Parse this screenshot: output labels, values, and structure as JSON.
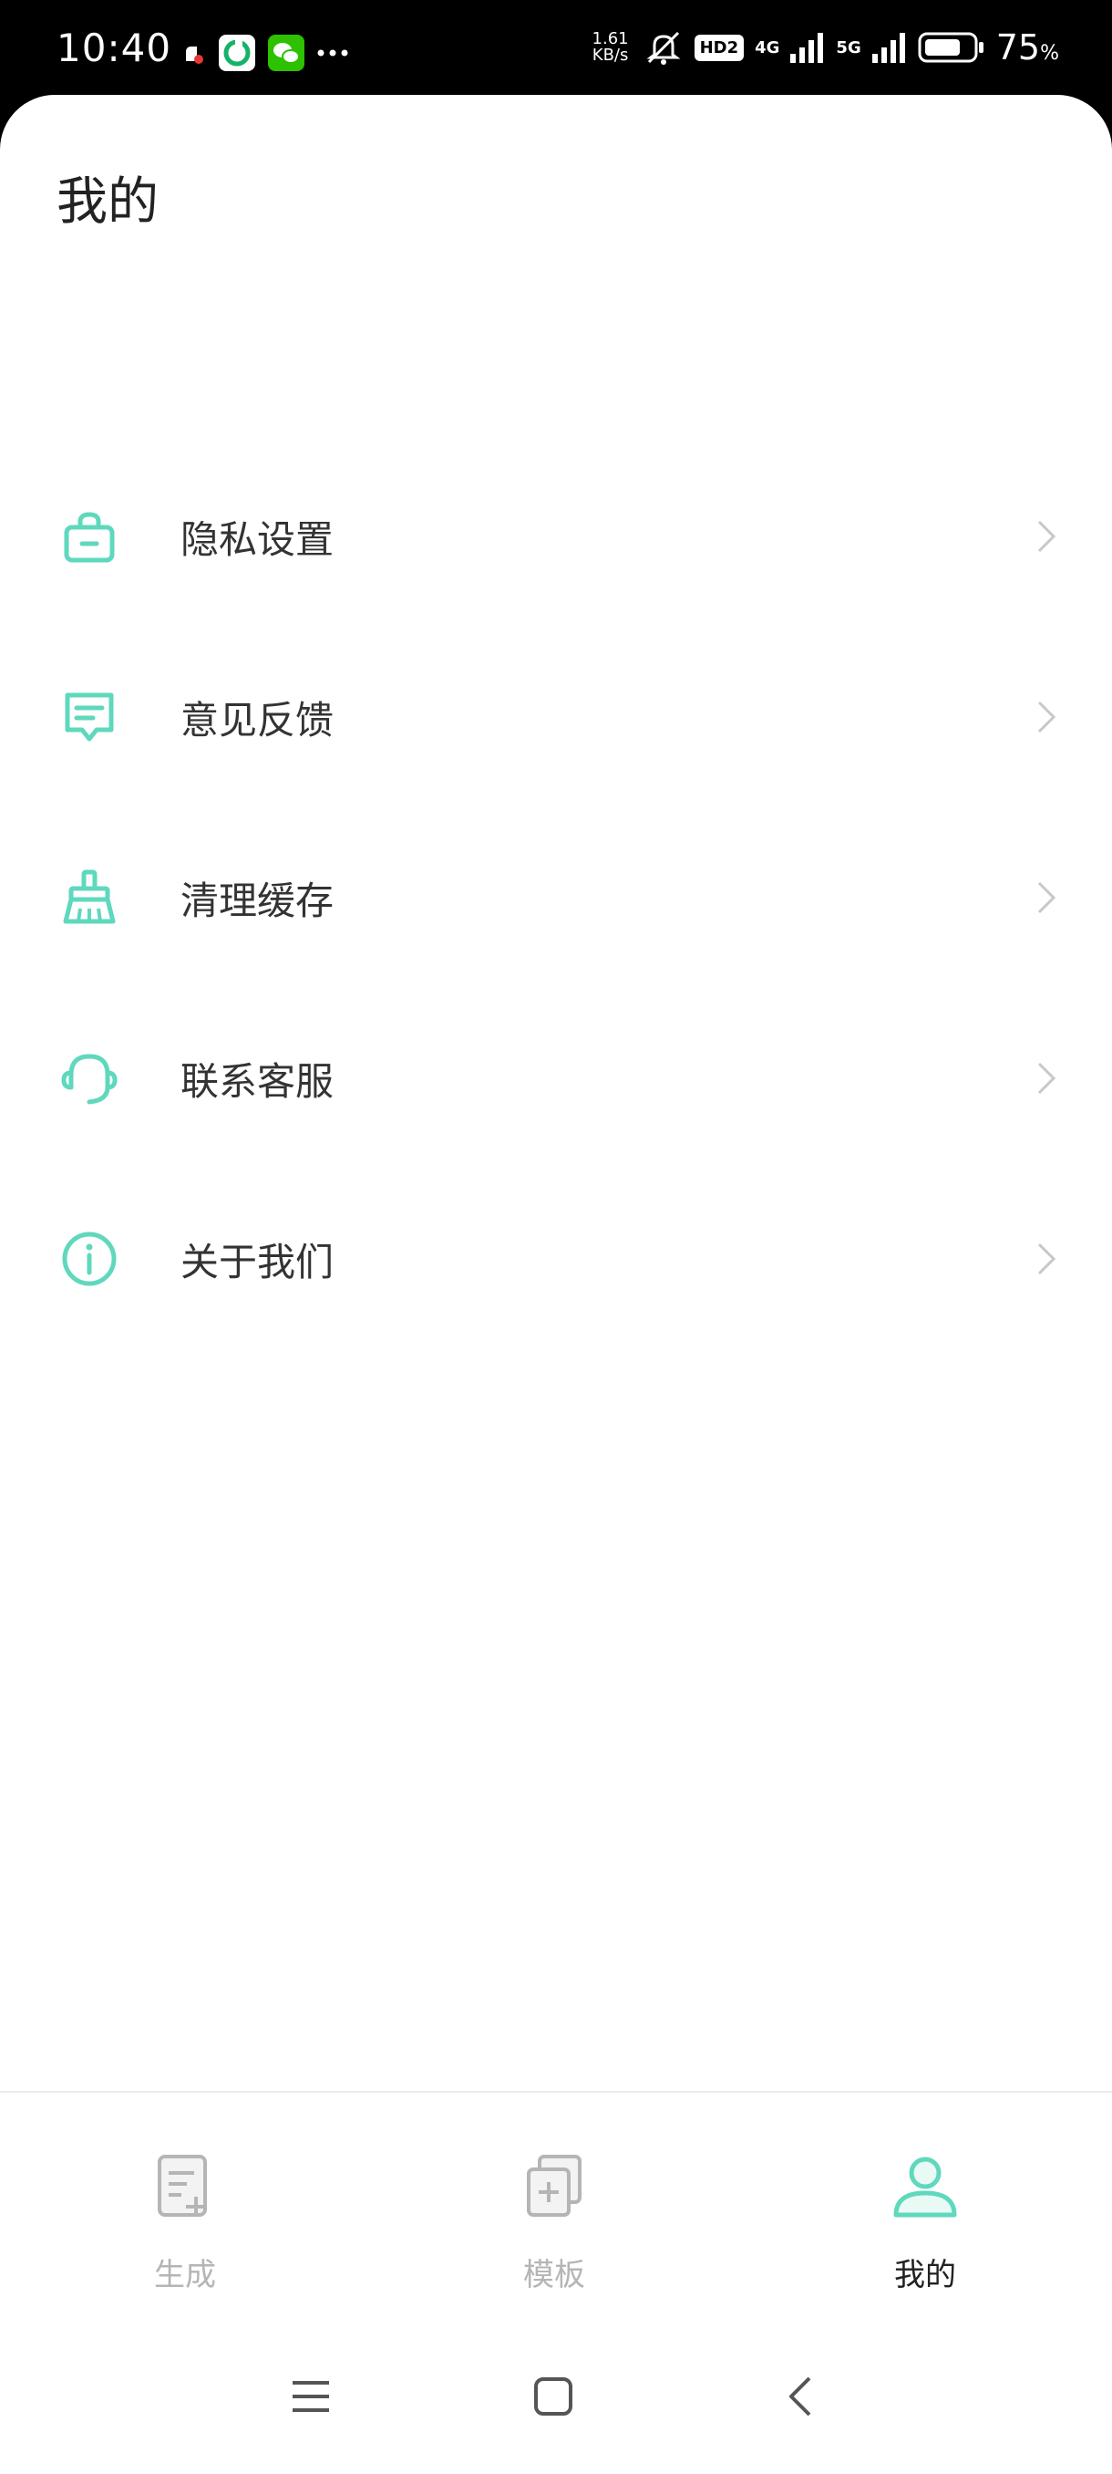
{
  "status_bar": {
    "time": "10:40",
    "net_speed_value": "1.61",
    "net_speed_unit": "KB/s",
    "hd_label": "HD2",
    "sim1_label": "4G",
    "sim2_label": "5G",
    "battery_percent": "75",
    "battery_unit": "%",
    "battery_level": 0.75
  },
  "page": {
    "title": "我的"
  },
  "menu": {
    "items": [
      {
        "label": "隐私设置",
        "icon": "lock-icon"
      },
      {
        "label": "意见反馈",
        "icon": "chat-icon"
      },
      {
        "label": "清理缓存",
        "icon": "broom-icon"
      },
      {
        "label": "联系客服",
        "icon": "headset-icon"
      },
      {
        "label": "关于我们",
        "icon": "info-icon"
      }
    ]
  },
  "tabs": [
    {
      "label": "生成",
      "icon": "document-plus-icon",
      "active": false
    },
    {
      "label": "模板",
      "icon": "template-icon",
      "active": false
    },
    {
      "label": "我的",
      "icon": "person-icon",
      "active": true
    }
  ],
  "colors": {
    "accent": "#5fd8bd",
    "inactive": "#b5b5b5",
    "text": "#333333"
  }
}
